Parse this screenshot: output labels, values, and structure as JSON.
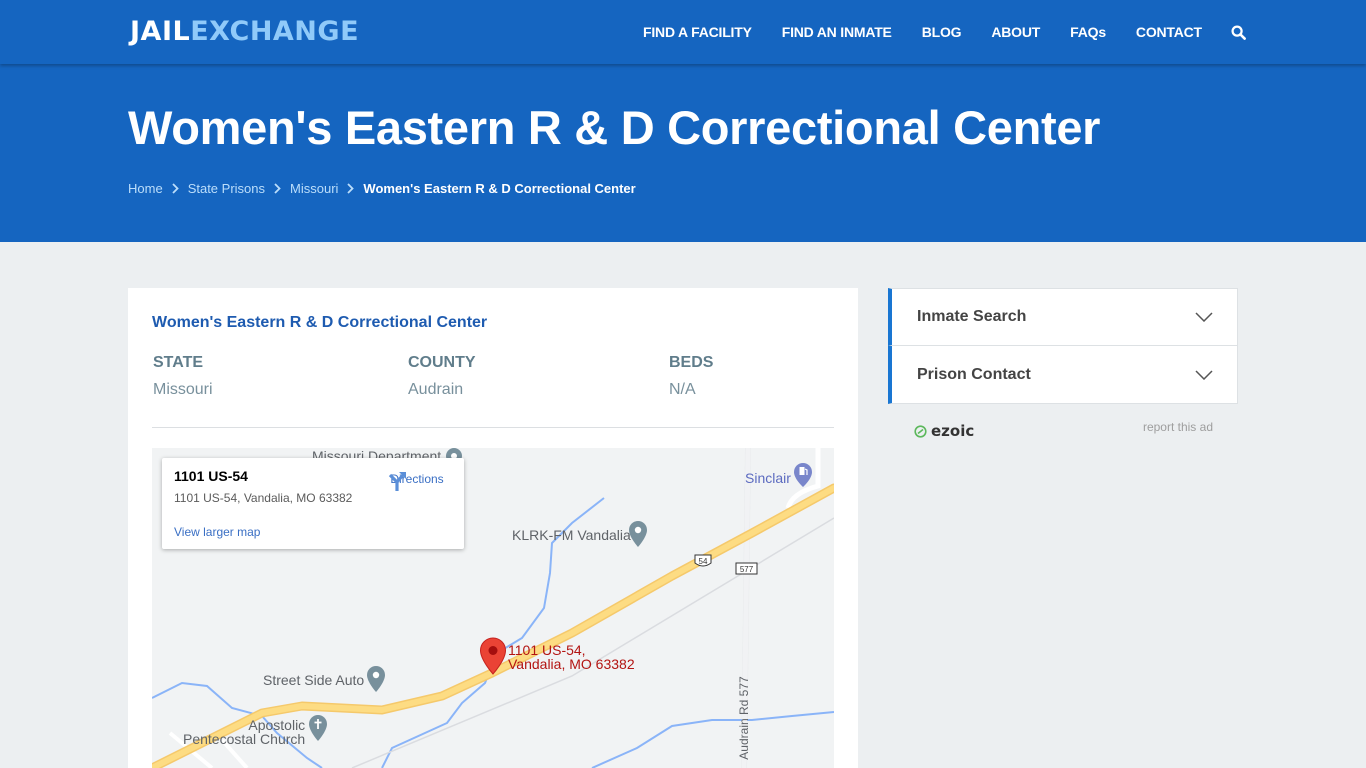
{
  "header": {
    "logo_part1": "JAIL",
    "logo_part2": "EXCHANGE",
    "nav": [
      {
        "label": "FIND A FACILITY"
      },
      {
        "label": "FIND AN INMATE"
      },
      {
        "label": "BLOG"
      },
      {
        "label": "ABOUT"
      },
      {
        "label": "FAQs"
      },
      {
        "label": "CONTACT"
      }
    ],
    "search_icon": "search-icon"
  },
  "hero": {
    "title": "Women's Eastern R & D Correctional Center",
    "breadcrumb": [
      {
        "label": "Home"
      },
      {
        "label": "State Prisons"
      },
      {
        "label": "Missouri"
      },
      {
        "label": "Women's Eastern R & D Correctional Center"
      }
    ]
  },
  "facility": {
    "name": "Women's Eastern R & D Correctional Center",
    "stats": [
      {
        "label": "STATE",
        "value": "Missouri"
      },
      {
        "label": "COUNTY",
        "value": "Audrain"
      },
      {
        "label": "BEDS",
        "value": "N/A"
      }
    ]
  },
  "map": {
    "info_title": "1101 US-54",
    "info_address": "1101 US-54, Vandalia, MO 63382",
    "directions_label": "Directions",
    "larger_map_label": "View larger map",
    "marker_label_line1": "1101 US-54,",
    "marker_label_line2": "Vandalia, MO 63382",
    "places": [
      {
        "name": "Missouri Department"
      },
      {
        "name": "Sinclair"
      },
      {
        "name": "KLRK-FM Vandalia"
      },
      {
        "name": "Street Side Auto"
      },
      {
        "name": "Apostolic"
      },
      {
        "name": "Pentecostal Church"
      }
    ],
    "road_labels": {
      "us54": "54",
      "rd577": "577",
      "audrain_rd": "Audrain Rd 577"
    }
  },
  "sidebar": {
    "accordions": [
      {
        "label": "Inmate Search"
      },
      {
        "label": "Prison Contact"
      }
    ],
    "ad_brand": "ezoic",
    "report_ad": "report this ad"
  }
}
